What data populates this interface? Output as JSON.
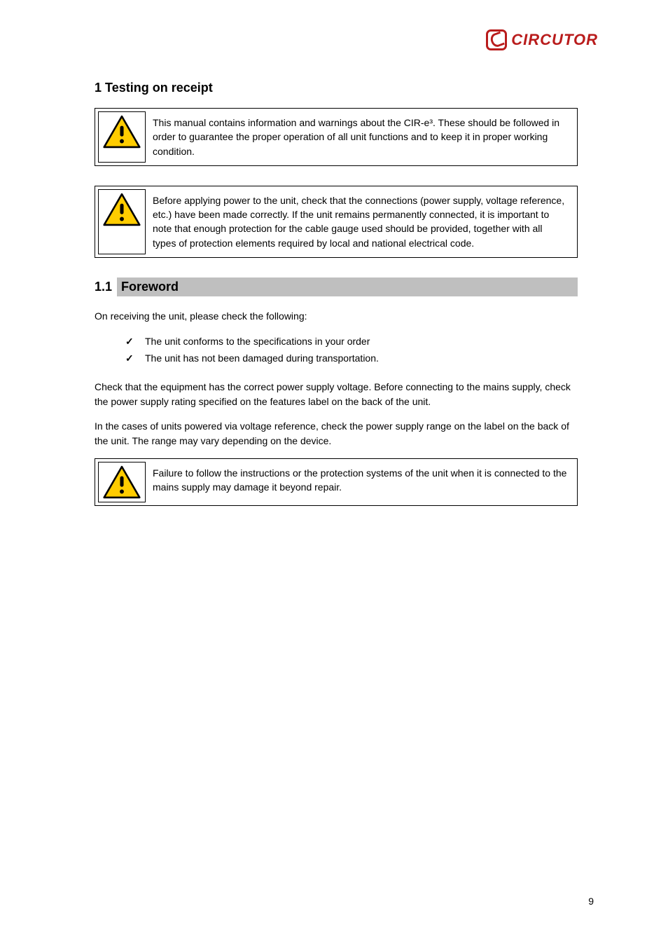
{
  "brand": "CIRCUTOR",
  "section_number": "1",
  "section_title": "Testing on receipt",
  "warning1": "This manual contains information and warnings about the CIR-e³. These should be followed in order to guarantee the proper operation of all unit functions and to keep it in proper working condition.",
  "warning2": "Before applying power to the unit, check that the connections (power supply, voltage reference, etc.) have been made correctly. If the unit remains permanently connected, it is important to note that enough protection for the cable gauge used should be provided, together with all types of protection elements required by local and national electrical code.",
  "subsection_number": "1.1",
  "subsection_title": "Foreword",
  "para1": "On receiving the unit, please check the following:",
  "checklist": [
    "The unit conforms to the specifications in your order",
    "The unit has not been damaged during transportation."
  ],
  "para2": "Check that the equipment has the correct power supply voltage. Before connecting to the mains supply, check the power supply rating specified on the features label on the back of the unit.",
  "para3": "In the cases of units powered via voltage reference, check the power supply range on the label on the back of the unit. The range may vary depending on the device.",
  "warning3": "Failure to follow the instructions or the protection systems of the unit when it is connected to the mains supply may damage it beyond repair.",
  "page_number": "9"
}
